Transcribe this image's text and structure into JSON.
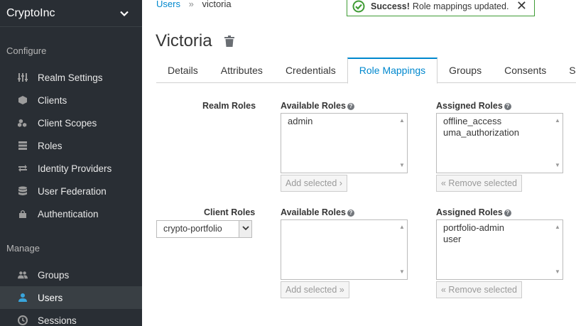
{
  "sidebar": {
    "realm": "CryptoInc",
    "sections": [
      {
        "title": "Configure"
      },
      {
        "title": "Manage"
      }
    ],
    "configure_items": [
      "Realm Settings",
      "Clients",
      "Client Scopes",
      "Roles",
      "Identity Providers",
      "User Federation",
      "Authentication"
    ],
    "manage_items": [
      "Groups",
      "Users",
      "Sessions"
    ]
  },
  "breadcrumb": {
    "root": "Users",
    "separator": "»",
    "current": "victoria"
  },
  "alert": {
    "strong": "Success!",
    "message": "Role mappings updated.",
    "close": "✕"
  },
  "page": {
    "title": "Victoria"
  },
  "tabs": [
    "Details",
    "Attributes",
    "Credentials",
    "Role Mappings",
    "Groups",
    "Consents",
    "S"
  ],
  "realm_roles": {
    "label": "Realm Roles",
    "available_label": "Available Roles",
    "assigned_label": "Assigned Roles",
    "available": [
      "admin"
    ],
    "assigned": [
      "offline_access",
      "uma_authorization"
    ],
    "add_button": "Add selected ›",
    "remove_button": "« Remove selected"
  },
  "client_roles": {
    "label": "Client Roles",
    "client_value": "crypto-portfolio",
    "available_label": "Available Roles",
    "assigned_label": "Assigned Roles",
    "available": [],
    "assigned": [
      "portfolio-admin",
      "user"
    ],
    "add_button": "Add selected »",
    "remove_button": "« Remove selected"
  },
  "help_glyph": "?",
  "colors": {
    "sidebar_bg": "#292e34",
    "accent": "#0088ce",
    "success": "#3f9c35"
  }
}
